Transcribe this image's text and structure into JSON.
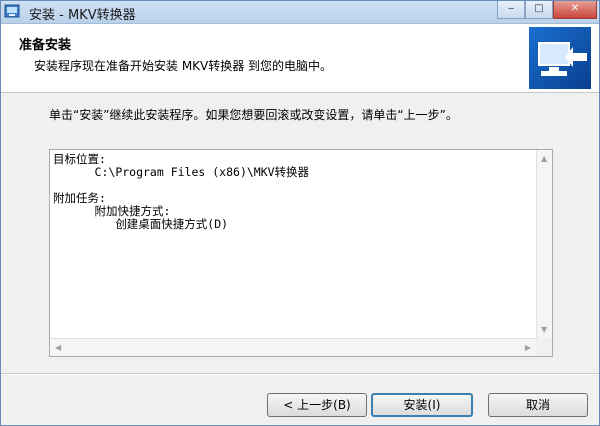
{
  "window": {
    "title": "安装 - MKV转换器"
  },
  "titlebar_buttons": {
    "minimize": "‒",
    "maximize": "□",
    "close": "✕"
  },
  "header": {
    "title": "准备安装",
    "subtitle": "安装程序现在准备开始安装 MKV转换器 到您的电脑中。"
  },
  "instruction": "单击“安装”继续此安装程序。如果您想要回滚或改变设置，请单击“上一步”。",
  "info": {
    "dest_label": "目标位置:",
    "dest_path": "C:\\Program Files (x86)\\MKV转换器",
    "tasks_label": "附加任务:",
    "task_group": "附加快捷方式:",
    "task_item": "创建桌面快捷方式(D)"
  },
  "buttons": {
    "back": "< 上一步(B)",
    "install": "安装(I)",
    "cancel": "取消"
  }
}
